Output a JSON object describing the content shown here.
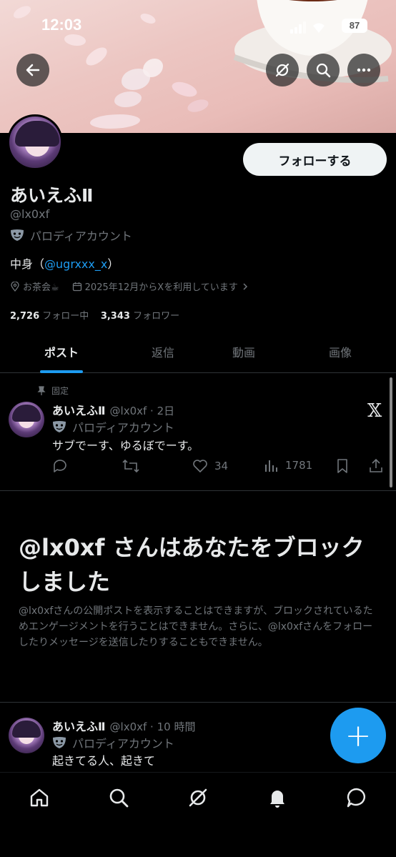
{
  "status_bar": {
    "time": "12:03",
    "battery": "87"
  },
  "header_actions": [
    "back-icon",
    "grok-icon",
    "search-icon",
    "more-icon"
  ],
  "profile": {
    "follow_label": "フォローする",
    "name": "あいえふⅡ",
    "handle": "@lx0xf",
    "parody_label": "パロディアカウント",
    "bio_prefix": "中身（",
    "bio_link": "@ugrxxx_x",
    "bio_suffix": "）",
    "location": "お茶会☕",
    "joined": "2025年12月からXを利用しています",
    "following_count": "2,726",
    "following_label": "フォロー中",
    "followers_count": "3,343",
    "followers_label": "フォロワー"
  },
  "tabs": [
    "ポスト",
    "返信",
    "動画",
    "画像"
  ],
  "pinned_post": {
    "pinned_label": "固定",
    "name": "あいえふⅡ",
    "meta": "@lx0xf · 2日",
    "parody_label": "パロディアカウント",
    "text": "サブでーす、ゆるぼでーす。",
    "likes": "34",
    "views": "1781"
  },
  "blocked": {
    "title": "@lx0xf さんはあなたをブロックしました",
    "body": "@lx0xfさんの公開ポストを表示することはできますが、ブロックされているためエンゲージメントを行うことはできません。さらに、@lx0xfさんをフォローしたりメッセージを送信したりすることもできません。"
  },
  "second_post": {
    "name": "あいえふⅡ",
    "meta": "@lx0xf · 10 時間",
    "parody_label": "パロディアカウント",
    "text": "起きてる人、起きて"
  },
  "fab_label": "+",
  "colors": {
    "accent": "#1d9bf0",
    "background": "#000000",
    "muted": "#71767b"
  }
}
